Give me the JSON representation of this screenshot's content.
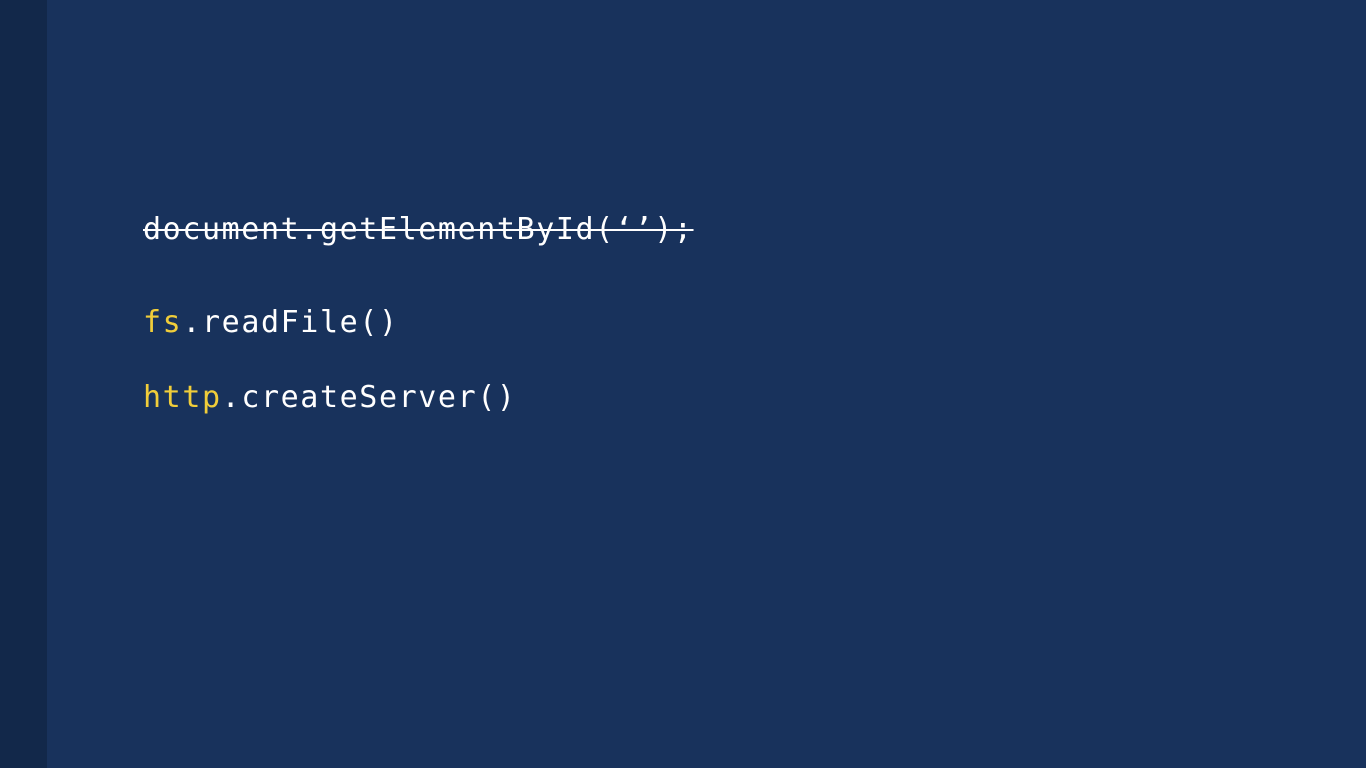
{
  "slide": {
    "lines": [
      {
        "text": "document.getElementById(‘’);",
        "struck": true
      },
      {
        "object": "fs",
        "method": ".readFile()"
      },
      {
        "object": "http",
        "method": ".createServer()"
      }
    ]
  },
  "colors": {
    "background": "#18325c",
    "side_strip": "#12284a",
    "text": "#ffffff",
    "highlight": "#f0cd3a"
  }
}
